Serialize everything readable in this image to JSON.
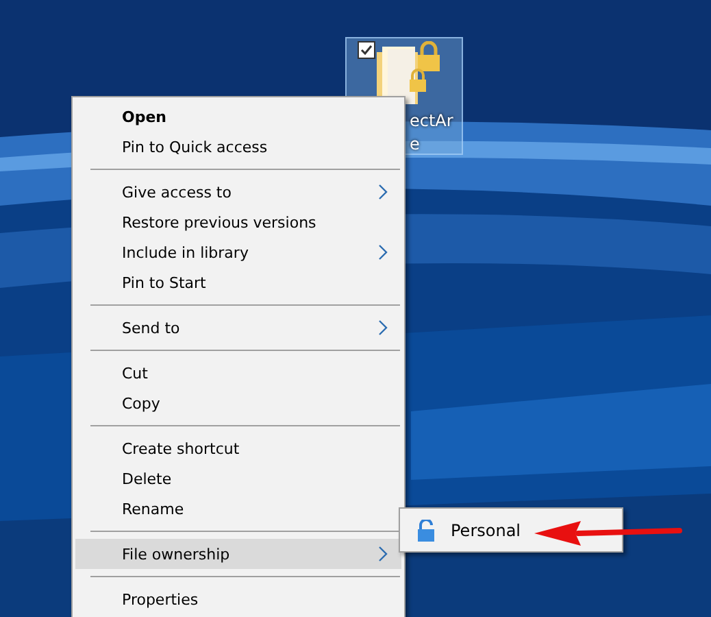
{
  "desktop_icon": {
    "label_lines": [
      "ectAr",
      "e"
    ],
    "checked": true
  },
  "context_menu": {
    "items": [
      {
        "kind": "item",
        "label": "Open",
        "default": true,
        "submenu": false,
        "selected": false
      },
      {
        "kind": "item",
        "label": "Pin to Quick access",
        "default": false,
        "submenu": false,
        "selected": false
      },
      {
        "kind": "separator"
      },
      {
        "kind": "item",
        "label": "Give access to",
        "default": false,
        "submenu": true,
        "selected": false
      },
      {
        "kind": "item",
        "label": "Restore previous versions",
        "default": false,
        "submenu": false,
        "selected": false
      },
      {
        "kind": "item",
        "label": "Include in library",
        "default": false,
        "submenu": true,
        "selected": false
      },
      {
        "kind": "item",
        "label": "Pin to Start",
        "default": false,
        "submenu": false,
        "selected": false
      },
      {
        "kind": "separator"
      },
      {
        "kind": "item",
        "label": "Send to",
        "default": false,
        "submenu": true,
        "selected": false
      },
      {
        "kind": "separator"
      },
      {
        "kind": "item",
        "label": "Cut",
        "default": false,
        "submenu": false,
        "selected": false
      },
      {
        "kind": "item",
        "label": "Copy",
        "default": false,
        "submenu": false,
        "selected": false
      },
      {
        "kind": "separator"
      },
      {
        "kind": "item",
        "label": "Create shortcut",
        "default": false,
        "submenu": false,
        "selected": false
      },
      {
        "kind": "item",
        "label": "Delete",
        "default": false,
        "submenu": false,
        "selected": false
      },
      {
        "kind": "item",
        "label": "Rename",
        "default": false,
        "submenu": false,
        "selected": false
      },
      {
        "kind": "separator"
      },
      {
        "kind": "item",
        "label": "File ownership",
        "default": false,
        "submenu": true,
        "selected": true
      },
      {
        "kind": "separator"
      },
      {
        "kind": "item",
        "label": "Properties",
        "default": false,
        "submenu": false,
        "selected": false
      }
    ]
  },
  "submenu": {
    "items": [
      {
        "label": "Personal"
      }
    ]
  }
}
